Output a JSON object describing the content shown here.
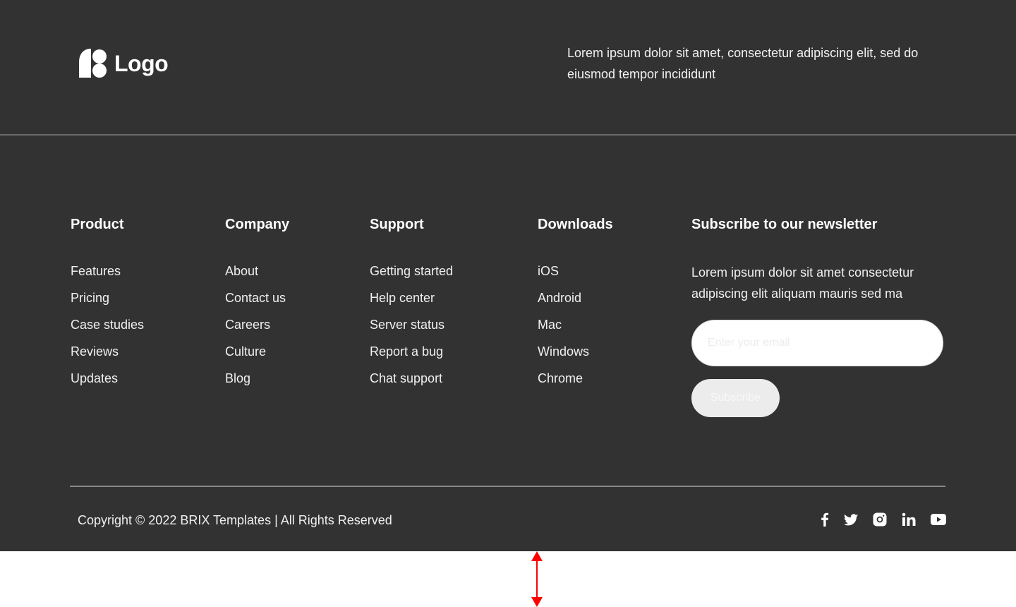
{
  "header": {
    "logo_text": "Logo",
    "description": "Lorem ipsum dolor sit amet, consectetur adipiscing elit, sed do eiusmod tempor incididunt"
  },
  "columns": [
    {
      "title": "Product",
      "items": [
        "Features",
        "Pricing",
        "Case studies",
        "Reviews",
        "Updates"
      ]
    },
    {
      "title": "Company",
      "items": [
        "About",
        "Contact us",
        "Careers",
        "Culture",
        "Blog"
      ]
    },
    {
      "title": "Support",
      "items": [
        "Getting started",
        "Help center",
        "Server status",
        "Report a bug",
        "Chat support"
      ]
    },
    {
      "title": "Downloads",
      "items": [
        "iOS",
        "Android",
        "Mac",
        "Windows",
        "Chrome"
      ]
    }
  ],
  "newsletter": {
    "title": "Subscribe to our newsletter",
    "text": "Lorem ipsum dolor sit amet consectetur adipiscing elit aliquam mauris sed ma",
    "email_placeholder": "Enter your email",
    "button_label": "Subscribe"
  },
  "footer_bottom": {
    "copyright": "Copyright © 2022 BRIX Templates | All Rights Reserved",
    "social_icons": [
      "facebook-icon",
      "twitter-icon",
      "instagram-icon",
      "linkedin-icon",
      "youtube-icon"
    ]
  },
  "colors": {
    "background": "#323232",
    "text": "#ffffff",
    "resize_indicator": "#ff0000"
  }
}
